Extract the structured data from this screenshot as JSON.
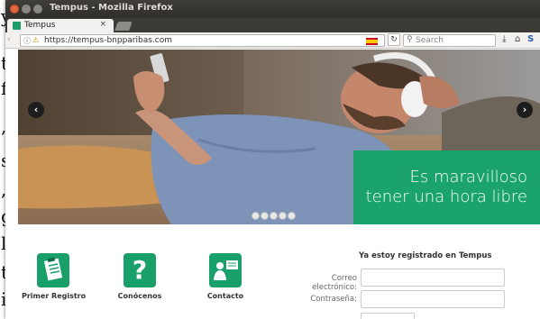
{
  "window": {
    "title": "Tempus - Mozilla Firefox"
  },
  "tab": {
    "label": "Tempus",
    "close": "×"
  },
  "navbar": {
    "url": "https://tempus-bnpparibas.com",
    "search_placeholder": "Search"
  },
  "hero": {
    "banner_line1": "Es maravilloso",
    "banner_line2": "tener una hora libre",
    "slide_count": 5
  },
  "features": [
    {
      "label": "Primer Registro",
      "icon": "clipboard-icon"
    },
    {
      "label": "Conócenos",
      "icon": "question-icon"
    },
    {
      "label": "Contacto",
      "icon": "contact-icon"
    }
  ],
  "login": {
    "title": "Ya estoy registrado en Tempus",
    "email_label": "Correo electrónico:",
    "password_label": "Contraseña:"
  },
  "colors": {
    "brand_green": "#1aa36a",
    "titlebar": "#3f3e3a"
  }
}
